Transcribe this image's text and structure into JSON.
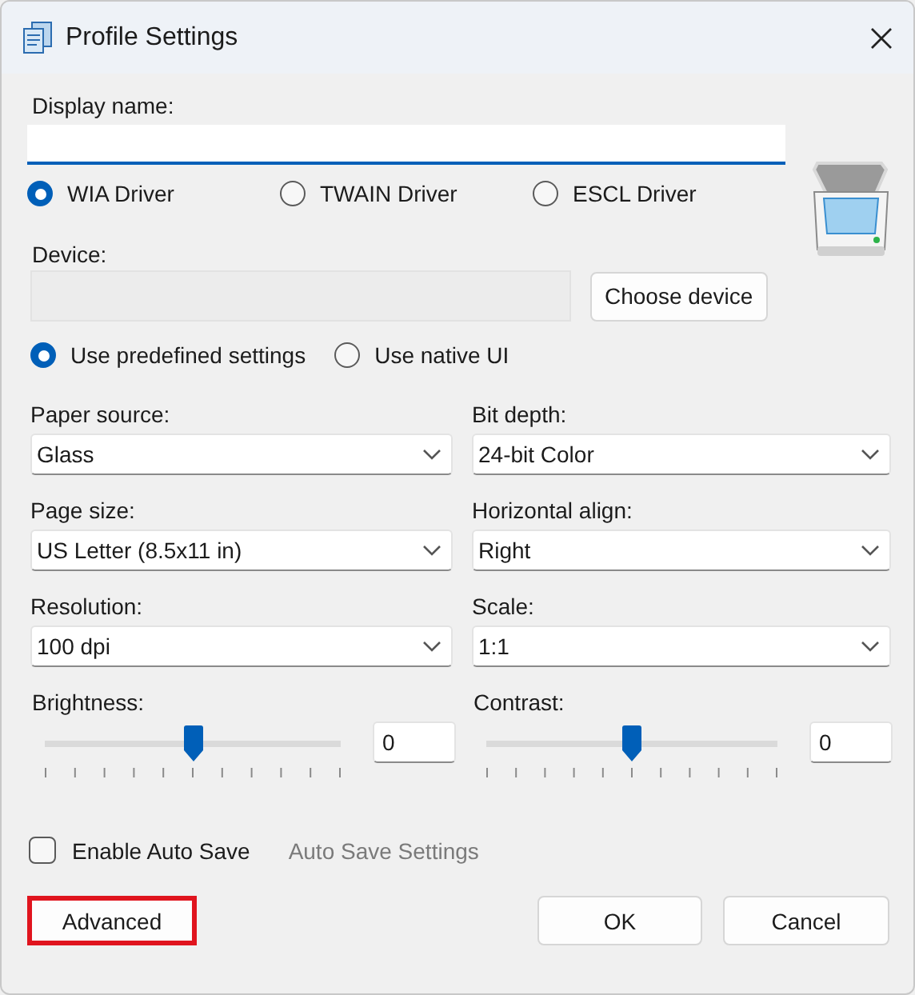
{
  "window": {
    "title": "Profile Settings"
  },
  "display_name": {
    "label": "Display name:"
  },
  "drivers": [
    {
      "label": "WIA Driver",
      "selected": true
    },
    {
      "label": "TWAIN Driver",
      "selected": false
    },
    {
      "label": "ESCL Driver",
      "selected": false
    }
  ],
  "device": {
    "label": "Device:",
    "button": "Choose device"
  },
  "modes": [
    {
      "label": "Use predefined settings",
      "selected": true
    },
    {
      "label": "Use native UI",
      "selected": false
    }
  ],
  "dropdowns": [
    {
      "label": "Paper source:",
      "value": "Glass"
    },
    {
      "label": "Bit depth:",
      "value": "24-bit Color"
    },
    {
      "label": "Page size:",
      "value": "US Letter (8.5x11 in)"
    },
    {
      "label": "Horizontal align:",
      "value": "Right"
    },
    {
      "label": "Resolution:",
      "value": "100 dpi"
    },
    {
      "label": "Scale:",
      "value": "1:1"
    }
  ],
  "sliders": [
    {
      "label": "Brightness:",
      "level": 0.5,
      "value": "0"
    },
    {
      "label": "Contrast:",
      "level": 0.5,
      "value": "0"
    }
  ],
  "auto_save": {
    "label": "Enable Auto Save",
    "checked": false
  },
  "auto_save_settings": {
    "label": "Auto Save Settings",
    "disabled": true
  },
  "buttons": [
    {
      "label": "Advanced",
      "highlighted": true
    },
    {
      "label": "OK",
      "highlighted": false
    },
    {
      "label": "Cancel",
      "highlighted": false
    }
  ]
}
